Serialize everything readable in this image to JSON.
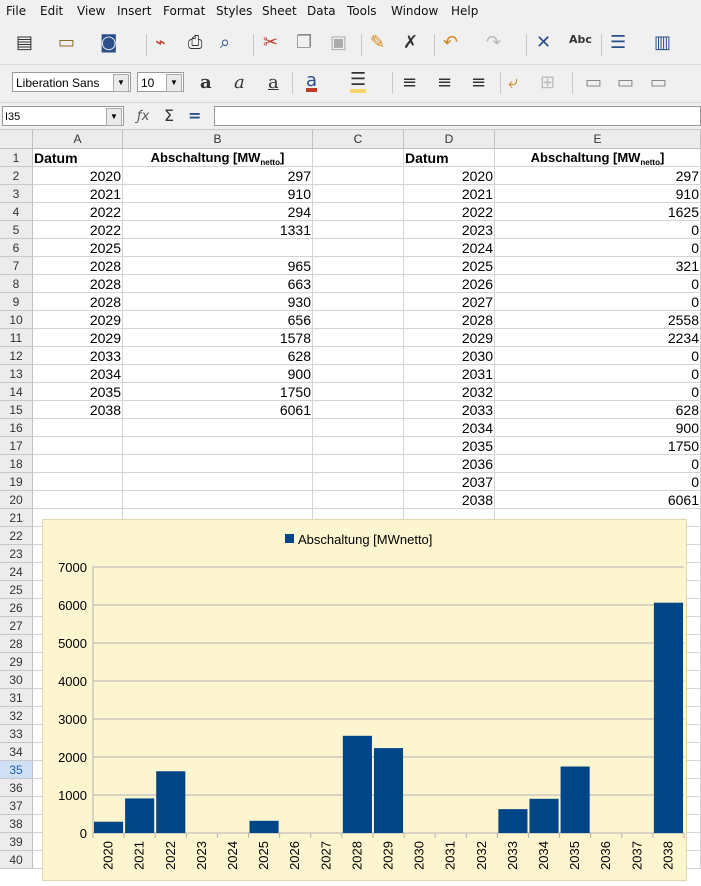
{
  "menu": {
    "file": "File",
    "edit": "Edit",
    "view": "View",
    "insert": "Insert",
    "format": "Format",
    "styles": "Styles",
    "sheet": "Sheet",
    "data": "Data",
    "tools": "Tools",
    "window": "Window",
    "help": "Help"
  },
  "toolbar": {
    "font_name": "Liberation Sans",
    "font_size": "10"
  },
  "formula_bar": {
    "cell_ref": "I35",
    "content": ""
  },
  "columns": [
    "A",
    "B",
    "C",
    "D",
    "E"
  ],
  "rows": [
    "1",
    "2",
    "3",
    "4",
    "5",
    "6",
    "7",
    "8",
    "9",
    "10",
    "11",
    "12",
    "13",
    "14",
    "15",
    "16",
    "17",
    "18",
    "19",
    "20",
    "21",
    "22",
    "23",
    "24",
    "25",
    "26",
    "27",
    "28",
    "29",
    "30",
    "31",
    "32",
    "33",
    "34",
    "35",
    "36",
    "37",
    "38",
    "39",
    "40"
  ],
  "selected_row": "35",
  "table1": {
    "h_date": "Datum",
    "h_value": "Abschaltung [MW",
    "h_value_sub": "netto",
    "h_close": "]",
    "years": [
      "2020",
      "2021",
      "2022",
      "2022",
      "2025",
      "2028",
      "2028",
      "2028",
      "2029",
      "2029",
      "2033",
      "2034",
      "2035",
      "2038"
    ],
    "values": [
      "297",
      "910",
      "294",
      "1331",
      "",
      "965",
      "663",
      "930",
      "656",
      "1578",
      "628",
      "900",
      "1750",
      "6061"
    ]
  },
  "table2": {
    "h_date": "Datum",
    "h_value": "Abschaltung [MW",
    "h_value_sub": "netto",
    "h_close": "]",
    "years": [
      "2020",
      "2021",
      "2022",
      "2023",
      "2024",
      "2025",
      "2026",
      "2027",
      "2028",
      "2029",
      "2030",
      "2031",
      "2032",
      "2033",
      "2034",
      "2035",
      "2036",
      "2037",
      "2038"
    ],
    "values": [
      "297",
      "910",
      "1625",
      "0",
      "0",
      "321",
      "0",
      "0",
      "2558",
      "2234",
      "0",
      "0",
      "0",
      "628",
      "900",
      "1750",
      "0",
      "0",
      "6061"
    ]
  },
  "chart_data": {
    "type": "bar",
    "legend_position": "top",
    "series": [
      {
        "name": "Abschaltung [MWnetto]",
        "values": [
          297,
          910,
          1625,
          0,
          0,
          321,
          0,
          0,
          2558,
          2234,
          0,
          0,
          0,
          628,
          900,
          1750,
          0,
          0,
          6061
        ],
        "color": "#004586"
      }
    ],
    "categories": [
      "2020",
      "2021",
      "2022",
      "2023",
      "2024",
      "2025",
      "2026",
      "2027",
      "2028",
      "2029",
      "2030",
      "2031",
      "2032",
      "2033",
      "2034",
      "2035",
      "2036",
      "2037",
      "2038"
    ],
    "ylim": [
      0,
      7000
    ],
    "yticks": [
      "0",
      "1000",
      "2000",
      "3000",
      "4000",
      "5000",
      "6000",
      "7000"
    ],
    "grid": true,
    "background": "#fdf5cf"
  }
}
